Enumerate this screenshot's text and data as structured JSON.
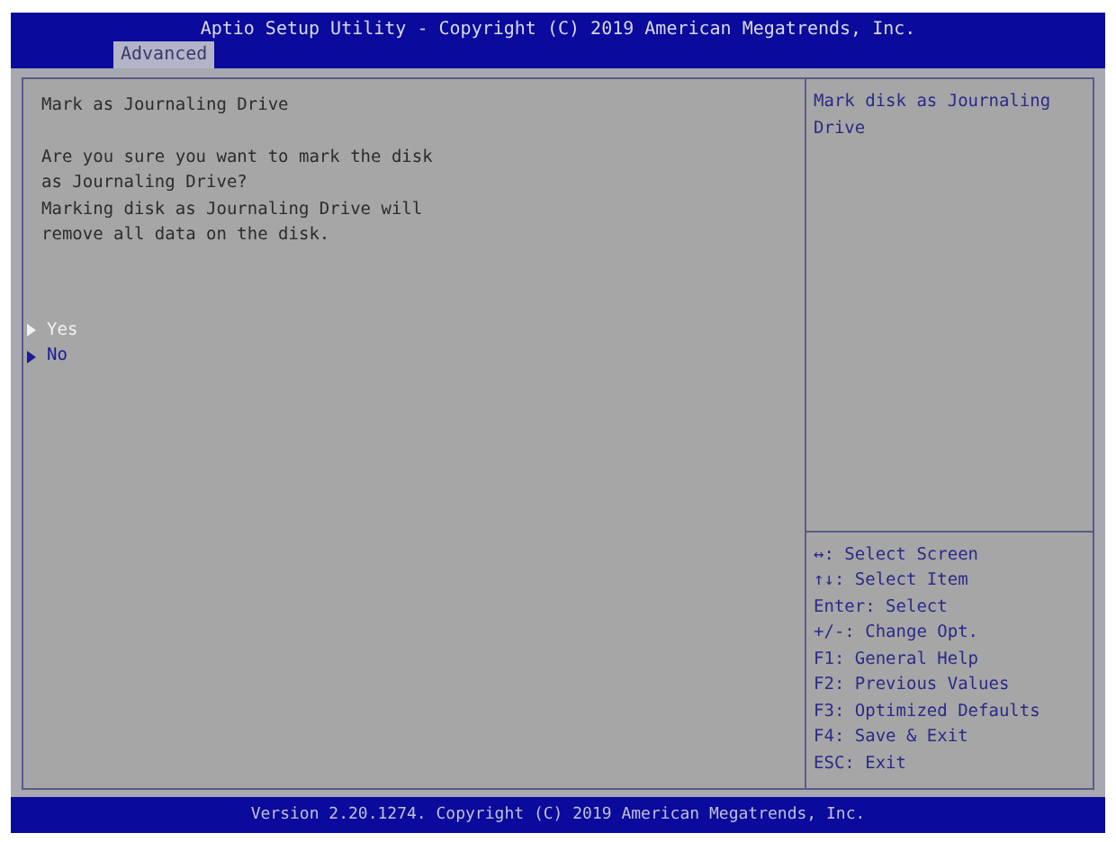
{
  "window": {
    "title": "Aptio Setup Utility - Copyright (C) 2019 American Megatrends, Inc."
  },
  "tabs": [
    {
      "label": "Advanced",
      "selected": true
    }
  ],
  "main": {
    "heading": "Mark as Journaling Drive",
    "message": [
      "Are you sure you want to mark the disk",
      "as Journaling Drive?",
      "Marking disk as Journaling Drive will",
      "remove all data on the disk."
    ],
    "options": [
      {
        "label": "Yes",
        "selected": true
      },
      {
        "label": "No",
        "selected": false
      }
    ]
  },
  "help": {
    "text": "Mark disk as Journaling Drive"
  },
  "keys": [
    "↔: Select Screen",
    "↑↓: Select Item",
    "Enter: Select",
    "+/-: Change Opt.",
    "F1: General Help",
    "F2: Previous Values",
    "F3: Optimized Defaults",
    "F4: Save & Exit",
    "ESC: Exit"
  ],
  "status_bar": "Version 2.20.1274. Copyright (C) 2019 American Megatrends, Inc."
}
